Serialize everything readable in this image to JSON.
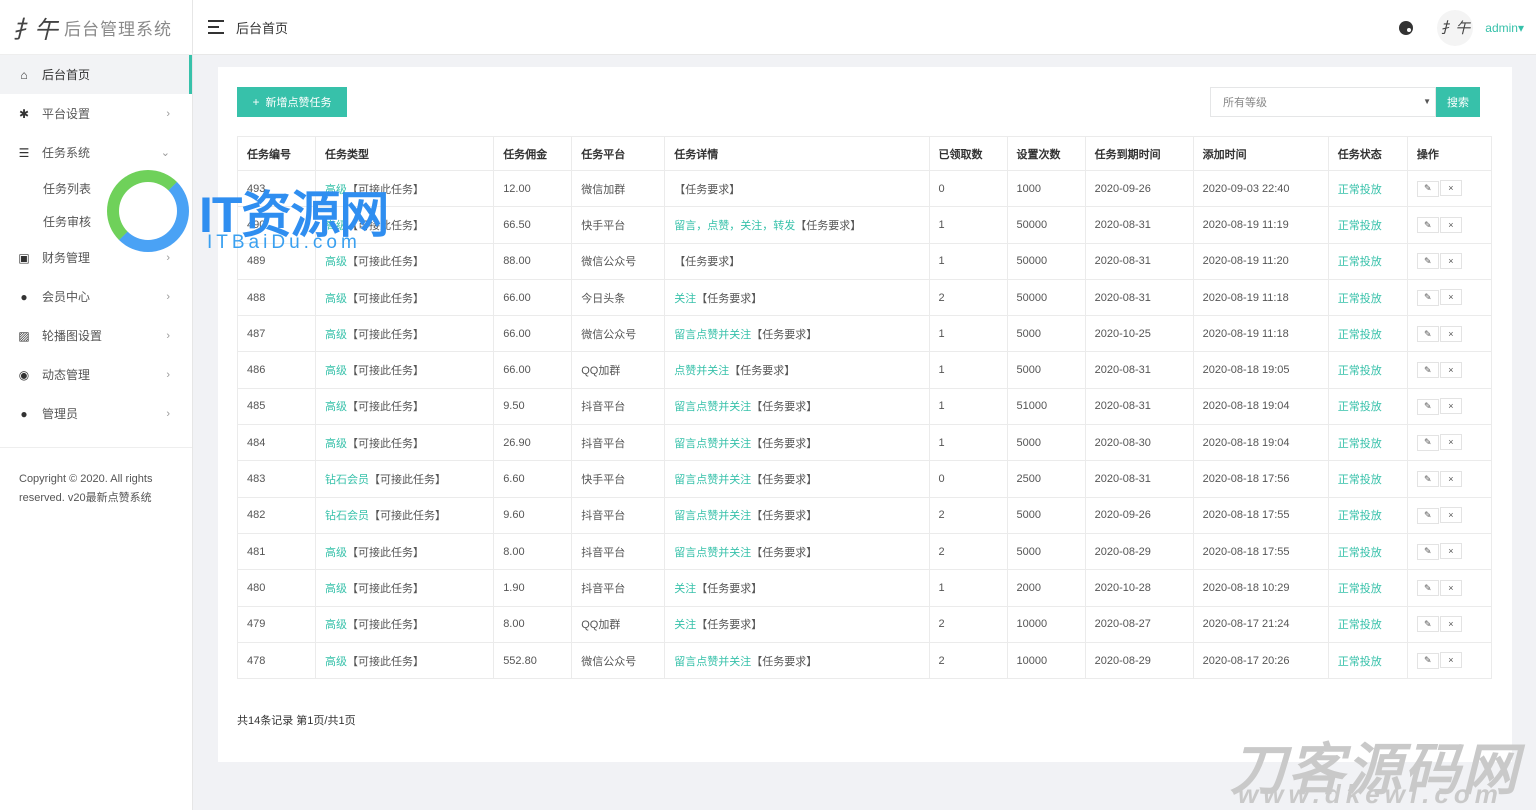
{
  "sidebar": {
    "logo_mark": "扌午",
    "logo_text": "后台管理系统",
    "items": [
      {
        "label": "后台首页",
        "icon": "home-icon",
        "active": true
      },
      {
        "label": "平台设置",
        "icon": "gear-icon",
        "arrow": "›"
      },
      {
        "label": "任务系统",
        "icon": "list-icon",
        "arrow": "⌄"
      },
      {
        "label": "财务管理",
        "icon": "money-icon",
        "arrow": "›"
      },
      {
        "label": "会员中心",
        "icon": "user-icon",
        "arrow": "›"
      },
      {
        "label": "轮播图设置",
        "icon": "image-icon",
        "arrow": "›"
      },
      {
        "label": "动态管理",
        "icon": "globe-icon",
        "arrow": "›"
      },
      {
        "label": "管理员",
        "icon": "user-icon",
        "arrow": "›"
      }
    ],
    "subitems": [
      "任务列表",
      "任务审核"
    ],
    "copyright_line1": "Copyright © 2020. All rights",
    "copyright_line2": "reserved. v20最新点赞系统"
  },
  "topbar": {
    "title": "后台首页",
    "avatar": "扌午",
    "user": "admin▾"
  },
  "toolbar": {
    "add_label": "新增点赞任务",
    "add_icon": "+",
    "level_placeholder": "所有等级",
    "search_label": "搜索"
  },
  "table": {
    "headers": [
      "任务编号",
      "任务类型",
      "任务佣金",
      "任务平台",
      "任务详情",
      "已领取数",
      "设置次数",
      "任务到期时间",
      "添加时间",
      "任务状态",
      "操作"
    ],
    "rows": [
      {
        "id": "493",
        "level": "高级",
        "type_suffix": "【可接此任务】",
        "commission": "12.00",
        "platform": "微信加群",
        "detail_green": "",
        "detail_suffix": "【任务要求】",
        "received": "0",
        "times": "1000",
        "expire": "2020-09-26",
        "added": "2020-09-03 22:40",
        "status": "正常投放"
      },
      {
        "id": "490",
        "level": "高级",
        "type_suffix": "【可接此任务】",
        "commission": "66.50",
        "platform": "快手平台",
        "detail_green": "留言，点赞，关注，转发",
        "detail_suffix": "【任务要求】",
        "received": "1",
        "times": "50000",
        "expire": "2020-08-31",
        "added": "2020-08-19 11:19",
        "status": "正常投放"
      },
      {
        "id": "489",
        "level": "高级",
        "type_suffix": "【可接此任务】",
        "commission": "88.00",
        "platform": "微信公众号",
        "detail_green": "",
        "detail_suffix": "【任务要求】",
        "received": "1",
        "times": "50000",
        "expire": "2020-08-31",
        "added": "2020-08-19 11:20",
        "status": "正常投放"
      },
      {
        "id": "488",
        "level": "高级",
        "type_suffix": "【可接此任务】",
        "commission": "66.00",
        "platform": "今日头条",
        "detail_green": "关注",
        "detail_suffix": "【任务要求】",
        "received": "2",
        "times": "50000",
        "expire": "2020-08-31",
        "added": "2020-08-19 11:18",
        "status": "正常投放"
      },
      {
        "id": "487",
        "level": "高级",
        "type_suffix": "【可接此任务】",
        "commission": "66.00",
        "platform": "微信公众号",
        "detail_green": "留言点赞并关注",
        "detail_suffix": "【任务要求】",
        "received": "1",
        "times": "5000",
        "expire": "2020-10-25",
        "added": "2020-08-19 11:18",
        "status": "正常投放"
      },
      {
        "id": "486",
        "level": "高级",
        "type_suffix": "【可接此任务】",
        "commission": "66.00",
        "platform": "QQ加群",
        "detail_green": "点赞并关注",
        "detail_suffix": "【任务要求】",
        "received": "1",
        "times": "5000",
        "expire": "2020-08-31",
        "added": "2020-08-18 19:05",
        "status": "正常投放"
      },
      {
        "id": "485",
        "level": "高级",
        "type_suffix": "【可接此任务】",
        "commission": "9.50",
        "platform": "抖音平台",
        "detail_green": "留言点赞并关注",
        "detail_suffix": "【任务要求】",
        "received": "1",
        "times": "51000",
        "expire": "2020-08-31",
        "added": "2020-08-18 19:04",
        "status": "正常投放"
      },
      {
        "id": "484",
        "level": "高级",
        "type_suffix": "【可接此任务】",
        "commission": "26.90",
        "platform": "抖音平台",
        "detail_green": "留言点赞并关注",
        "detail_suffix": "【任务要求】",
        "received": "1",
        "times": "5000",
        "expire": "2020-08-30",
        "added": "2020-08-18 19:04",
        "status": "正常投放"
      },
      {
        "id": "483",
        "level": "钻石会员",
        "type_suffix": "【可接此任务】",
        "commission": "6.60",
        "platform": "快手平台",
        "detail_green": "留言点赞并关注",
        "detail_suffix": "【任务要求】",
        "received": "0",
        "times": "2500",
        "expire": "2020-08-31",
        "added": "2020-08-18 17:56",
        "status": "正常投放"
      },
      {
        "id": "482",
        "level": "钻石会员",
        "type_suffix": "【可接此任务】",
        "commission": "9.60",
        "platform": "抖音平台",
        "detail_green": "留言点赞并关注",
        "detail_suffix": "【任务要求】",
        "received": "2",
        "times": "5000",
        "expire": "2020-09-26",
        "added": "2020-08-18 17:55",
        "status": "正常投放"
      },
      {
        "id": "481",
        "level": "高级",
        "type_suffix": "【可接此任务】",
        "commission": "8.00",
        "platform": "抖音平台",
        "detail_green": "留言点赞并关注",
        "detail_suffix": "【任务要求】",
        "received": "2",
        "times": "5000",
        "expire": "2020-08-29",
        "added": "2020-08-18 17:55",
        "status": "正常投放"
      },
      {
        "id": "480",
        "level": "高级",
        "type_suffix": "【可接此任务】",
        "commission": "1.90",
        "platform": "抖音平台",
        "detail_green": "关注",
        "detail_suffix": "【任务要求】",
        "received": "1",
        "times": "2000",
        "expire": "2020-10-28",
        "added": "2020-08-18 10:29",
        "status": "正常投放"
      },
      {
        "id": "479",
        "level": "高级",
        "type_suffix": "【可接此任务】",
        "commission": "8.00",
        "platform": "QQ加群",
        "detail_green": "关注",
        "detail_suffix": "【任务要求】",
        "received": "2",
        "times": "10000",
        "expire": "2020-08-27",
        "added": "2020-08-17 21:24",
        "status": "正常投放"
      },
      {
        "id": "478",
        "level": "高级",
        "type_suffix": "【可接此任务】",
        "commission": "552.80",
        "platform": "微信公众号",
        "detail_green": "留言点赞并关注",
        "detail_suffix": "【任务要求】",
        "received": "2",
        "times": "10000",
        "expire": "2020-08-29",
        "added": "2020-08-17 20:26",
        "status": "正常投放"
      }
    ],
    "edit_icon": "✎",
    "delete_icon": "×"
  },
  "pager": {
    "text": "共14条记录 第1页/共1页"
  },
  "watermarks": {
    "it_text": "IT资源网",
    "it_sub": "ITBaiDu.com",
    "dk_text": "刀客源码网",
    "dk_sub": "www.dkewl.com"
  },
  "colors": {
    "accent": "#37c1aa"
  }
}
